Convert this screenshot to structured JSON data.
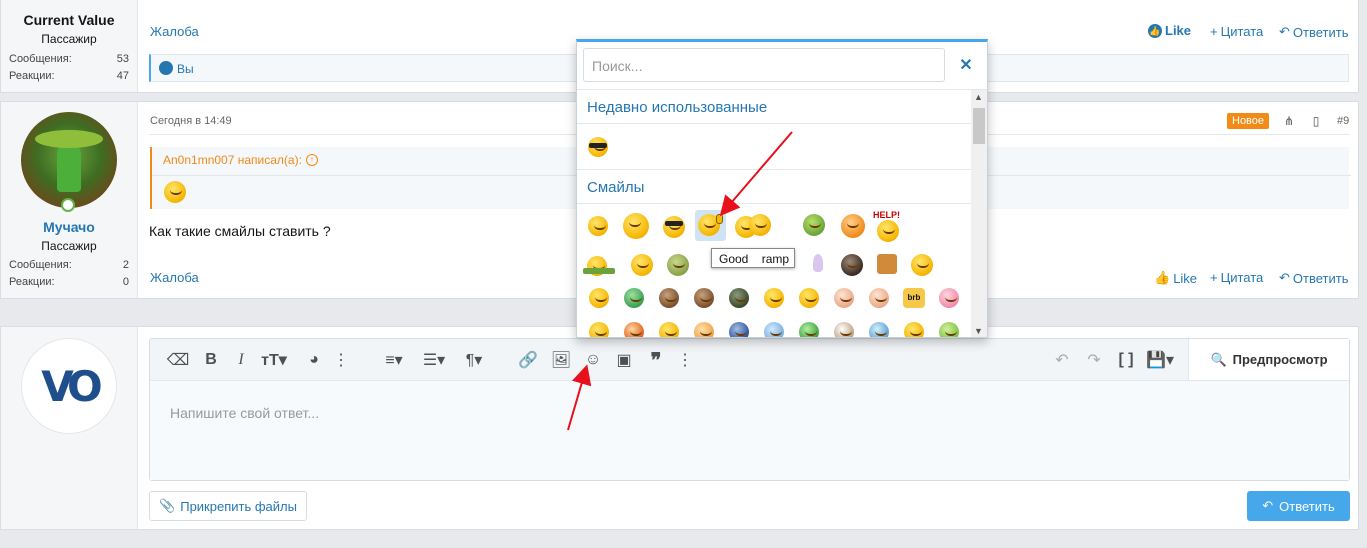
{
  "post1": {
    "username": "Current Value",
    "user_title": "Пассажир",
    "stats": [
      {
        "label": "Сообщения:",
        "value": "53"
      },
      {
        "label": "Реакции:",
        "value": "47"
      }
    ],
    "report": "Жалоба",
    "like": "Like",
    "quote": "Цитата",
    "reply": "Ответить",
    "reactions_text": "Вы"
  },
  "post2": {
    "username": "Мучачо",
    "user_title": "Пассажир",
    "stats": [
      {
        "label": "Сообщения:",
        "value": "2"
      },
      {
        "label": "Реакции:",
        "value": "0"
      }
    ],
    "date": "Сегодня в 14:49",
    "badge_new": "Новое",
    "post_number": "#9",
    "quote_author": "An0n1mn007 написал(а):",
    "body": "Как такие смайлы ставить ?",
    "report": "Жалоба",
    "like": "Like",
    "quote": "Цитата",
    "reply": "Ответить"
  },
  "editor": {
    "placeholder": "Напишите свой ответ...",
    "preview": "Предпросмотр",
    "attach": "Прикрепить файлы",
    "submit": "Ответить",
    "avatar_text": "VO"
  },
  "smilies": {
    "search_placeholder": "Поиск...",
    "recent_header": "Недавно использованные",
    "smiles_header": "Смайлы",
    "tooltip": "Good    ramp",
    "help_text": "HELP!",
    "brb_text": "brb"
  },
  "colors": {
    "accent": "#2577b1",
    "orange": "#f18a17",
    "submit_bg": "#47a7eb"
  }
}
